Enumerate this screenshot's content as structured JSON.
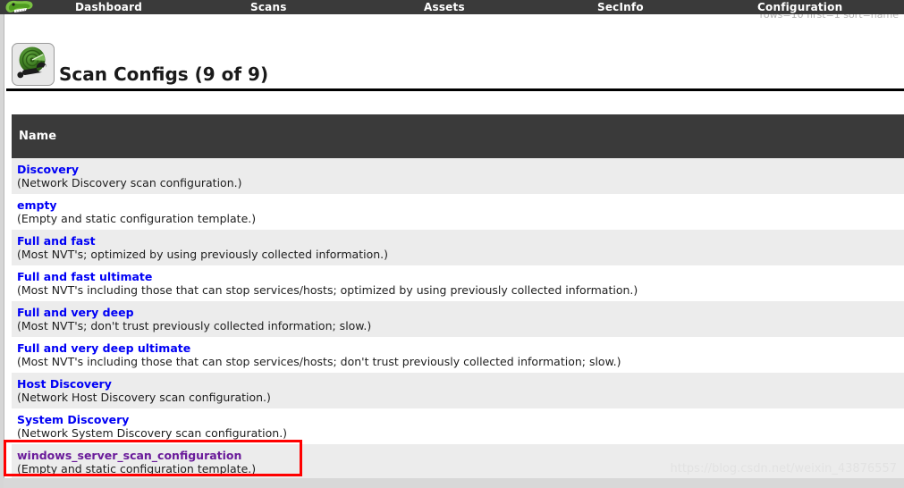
{
  "topnav": {
    "logo_icon": "greenbone-dragon-logo",
    "items": [
      {
        "label": "Dashboard"
      },
      {
        "label": "Scans"
      },
      {
        "label": "Assets"
      },
      {
        "label": "SecInfo"
      },
      {
        "label": "Configuration"
      }
    ]
  },
  "param_hint": "rows=10 first=1 sort=name",
  "header": {
    "icon": "scan-config-radar-wrench-icon",
    "title": "Scan Configs (9 of 9)"
  },
  "table": {
    "columns": [
      "Name"
    ],
    "rows": [
      {
        "name": "Discovery",
        "description": "(Network Discovery scan configuration.)",
        "visited": false
      },
      {
        "name": "empty",
        "description": "(Empty and static configuration template.)",
        "visited": false
      },
      {
        "name": "Full and fast",
        "description": "(Most NVT's; optimized by using previously collected information.)",
        "visited": false
      },
      {
        "name": "Full and fast ultimate",
        "description": "(Most NVT's including those that can stop services/hosts; optimized by using previously collected information.)",
        "visited": false
      },
      {
        "name": "Full and very deep",
        "description": "(Most NVT's; don't trust previously collected information; slow.)",
        "visited": false
      },
      {
        "name": "Full and very deep ultimate",
        "description": "(Most NVT's including those that can stop services/hosts; don't trust previously collected information; slow.)",
        "visited": false
      },
      {
        "name": "Host Discovery",
        "description": "(Network Host Discovery scan configuration.)",
        "visited": false
      },
      {
        "name": "System Discovery",
        "description": "(Network System Discovery scan configuration.)",
        "visited": false
      },
      {
        "name": "windows_server_scan_configuration",
        "description": "(Empty and static configuration template.)",
        "visited": true
      }
    ]
  },
  "annotation": {
    "target": "windows_server_scan_configuration",
    "color": "#ff0000"
  },
  "watermark": "https://blog.csdn.net/weixin_43876557",
  "colors": {
    "navbar_bg": "#3a3a3a",
    "table_header_bg": "#3a3a3a",
    "row_alt_bg": "#ececec",
    "row_bg": "#ffffff",
    "link": "#0000f5",
    "link_visited": "#6a1b9a",
    "rule": "#000000"
  }
}
